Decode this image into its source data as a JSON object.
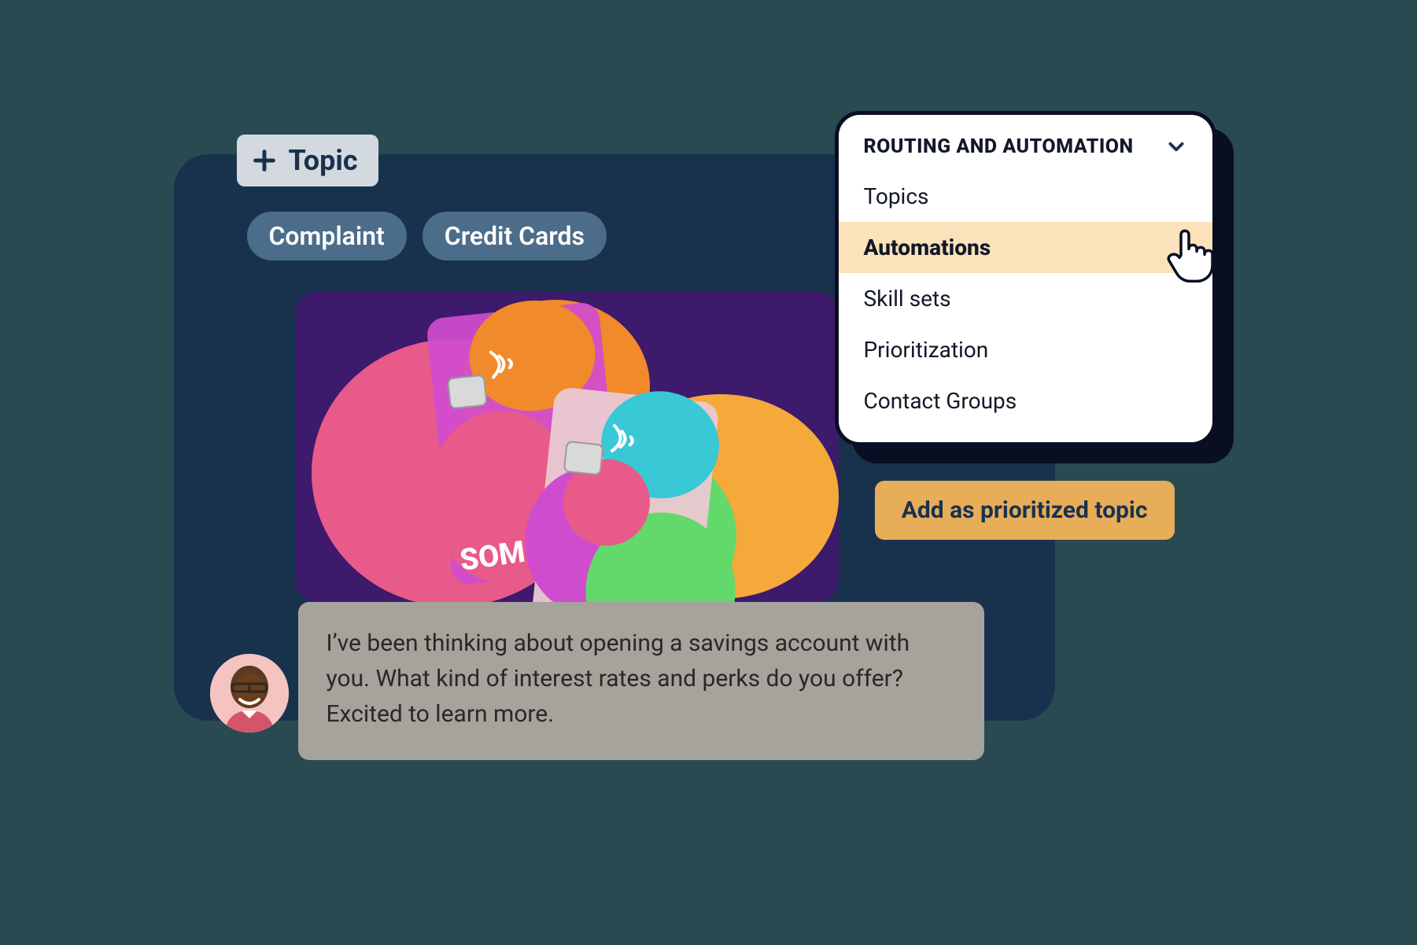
{
  "topic_button": {
    "label": "Topic"
  },
  "chips": [
    {
      "label": "Complaint"
    },
    {
      "label": "Credit Cards"
    }
  ],
  "hero": {
    "brand_text": "SOMOS"
  },
  "menu": {
    "title": "ROUTING AND AUTOMATION",
    "items": [
      {
        "label": "Topics",
        "selected": false
      },
      {
        "label": "Automations",
        "selected": true
      },
      {
        "label": "Skill sets",
        "selected": false
      },
      {
        "label": "Prioritization",
        "selected": false
      },
      {
        "label": "Contact Groups",
        "selected": false
      }
    ]
  },
  "action": {
    "label": "Add as prioritized topic"
  },
  "message": {
    "text": "I’ve been thinking about opening a savings account with you. What kind of interest rates and perks do you offer? Excited to learn more."
  },
  "colors": {
    "background": "#2a4a52",
    "navy": "#18324e",
    "chip": "#4c6d8a",
    "highlight": "#fbe2bb",
    "amber": "#e8ad59",
    "bubble": "#a6a29c"
  }
}
